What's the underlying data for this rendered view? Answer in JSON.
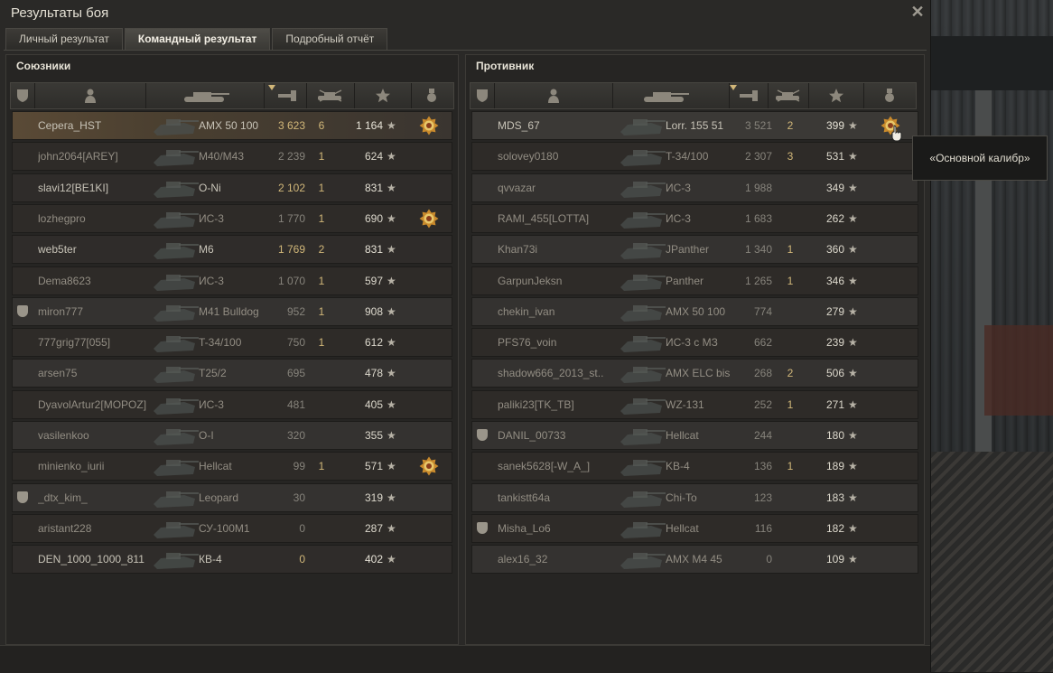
{
  "window": {
    "title": "Результаты боя",
    "close_symbol": "✕"
  },
  "tabs": [
    {
      "label": "Личный результат",
      "active": false
    },
    {
      "label": "Командный результат",
      "active": true
    },
    {
      "label": "Подробный отчёт",
      "active": false
    }
  ],
  "allies": {
    "title": "Союзники",
    "rows": [
      {
        "clan_icon": false,
        "name": "Серега_HST",
        "vehicle": "AMX 50 100",
        "damage": "3 623",
        "damage_gold": true,
        "kills": "6",
        "xp": "1 164",
        "medal": true,
        "style": "self"
      },
      {
        "clan_icon": false,
        "name": "john2064[AREY]",
        "vehicle": "M40/M43",
        "damage": "2 239",
        "damage_gold": false,
        "kills": "1",
        "xp": "624",
        "medal": false,
        "style": "faded"
      },
      {
        "clan_icon": false,
        "name": "slavi12[BE1KI]",
        "vehicle": "O-Ni",
        "damage": "2 102",
        "damage_gold": true,
        "kills": "1",
        "xp": "831",
        "medal": false,
        "style": "bright"
      },
      {
        "clan_icon": false,
        "name": "lozhegpro",
        "vehicle": "ИС-3",
        "damage": "1 770",
        "damage_gold": false,
        "kills": "1",
        "xp": "690",
        "medal": true,
        "style": "faded"
      },
      {
        "clan_icon": false,
        "name": "web5ter",
        "vehicle": "M6",
        "damage": "1 769",
        "damage_gold": true,
        "kills": "2",
        "xp": "831",
        "medal": false,
        "style": "bright"
      },
      {
        "clan_icon": false,
        "name": "Dema8623",
        "vehicle": "ИС-3",
        "damage": "1 070",
        "damage_gold": false,
        "kills": "1",
        "xp": "597",
        "medal": false,
        "style": "faded"
      },
      {
        "clan_icon": true,
        "name": "miron777",
        "vehicle": "M41 Bulldog",
        "damage": "952",
        "damage_gold": false,
        "kills": "1",
        "xp": "908",
        "medal": false,
        "style": "faded"
      },
      {
        "clan_icon": false,
        "name": "777grig77[055]",
        "vehicle": "T-34/100",
        "damage": "750",
        "damage_gold": false,
        "kills": "1",
        "xp": "612",
        "medal": false,
        "style": "faded"
      },
      {
        "clan_icon": false,
        "name": "arsen75",
        "vehicle": "T25/2",
        "damage": "695",
        "damage_gold": false,
        "kills": "",
        "xp": "478",
        "medal": false,
        "style": "faded"
      },
      {
        "clan_icon": false,
        "name": "DyavolArtur2[MOPOZ]",
        "vehicle": "ИС-3",
        "damage": "481",
        "damage_gold": false,
        "kills": "",
        "xp": "405",
        "medal": false,
        "style": "faded"
      },
      {
        "clan_icon": false,
        "name": "vasilenkoo",
        "vehicle": "O-I",
        "damage": "320",
        "damage_gold": false,
        "kills": "",
        "xp": "355",
        "medal": false,
        "style": "faded"
      },
      {
        "clan_icon": false,
        "name": "minienko_iurii",
        "vehicle": "Hellcat",
        "damage": "99",
        "damage_gold": false,
        "kills": "1",
        "xp": "571",
        "medal": true,
        "style": "faded"
      },
      {
        "clan_icon": true,
        "name": "_dtx_kim_",
        "vehicle": "Leopard",
        "damage": "30",
        "damage_gold": false,
        "kills": "",
        "xp": "319",
        "medal": false,
        "style": "faded"
      },
      {
        "clan_icon": false,
        "name": "aristant228",
        "vehicle": "СУ-100М1",
        "damage": "0",
        "damage_gold": false,
        "kills": "",
        "xp": "287",
        "medal": false,
        "style": "faded"
      },
      {
        "clan_icon": false,
        "name": "DEN_1000_1000_811",
        "vehicle": "КВ-4",
        "damage": "0",
        "damage_gold": true,
        "kills": "",
        "xp": "402",
        "medal": false,
        "style": "bright"
      }
    ]
  },
  "enemies": {
    "title": "Противник",
    "rows": [
      {
        "clan_icon": false,
        "name": "MDS_67",
        "vehicle": "Lorr. 155 51",
        "damage": "3 521",
        "damage_gold": false,
        "kills": "2",
        "xp": "399",
        "medal": true,
        "style": "hover"
      },
      {
        "clan_icon": false,
        "name": "solovey0180",
        "vehicle": "T-34/100",
        "damage": "2 307",
        "damage_gold": false,
        "kills": "3",
        "xp": "531",
        "medal": false,
        "style": "faded"
      },
      {
        "clan_icon": false,
        "name": "qvvazar",
        "vehicle": "ИС-3",
        "damage": "1 988",
        "damage_gold": false,
        "kills": "",
        "xp": "349",
        "medal": false,
        "style": "faded"
      },
      {
        "clan_icon": false,
        "name": "RAMI_455[LOTTA]",
        "vehicle": "ИС-3",
        "damage": "1 683",
        "damage_gold": false,
        "kills": "",
        "xp": "262",
        "medal": false,
        "style": "faded"
      },
      {
        "clan_icon": false,
        "name": "Khan73i",
        "vehicle": "JPanther",
        "damage": "1 340",
        "damage_gold": false,
        "kills": "1",
        "xp": "360",
        "medal": false,
        "style": "faded"
      },
      {
        "clan_icon": false,
        "name": "GarpunJeksn",
        "vehicle": "Panther",
        "damage": "1 265",
        "damage_gold": false,
        "kills": "1",
        "xp": "346",
        "medal": false,
        "style": "faded"
      },
      {
        "clan_icon": false,
        "name": "chekin_ivan",
        "vehicle": "AMX 50 100",
        "damage": "774",
        "damage_gold": false,
        "kills": "",
        "xp": "279",
        "medal": false,
        "style": "faded"
      },
      {
        "clan_icon": false,
        "name": "PFS76_voin",
        "vehicle": "ИС-3 с МЗ",
        "damage": "662",
        "damage_gold": false,
        "kills": "",
        "xp": "239",
        "medal": false,
        "style": "faded"
      },
      {
        "clan_icon": false,
        "name": "shadow666_2013_st..",
        "vehicle": "AMX ELC bis",
        "damage": "268",
        "damage_gold": false,
        "kills": "2",
        "xp": "506",
        "medal": false,
        "style": "faded"
      },
      {
        "clan_icon": false,
        "name": "paliki23[TK_TB]",
        "vehicle": "WZ-131",
        "damage": "252",
        "damage_gold": false,
        "kills": "1",
        "xp": "271",
        "medal": false,
        "style": "faded"
      },
      {
        "clan_icon": true,
        "name": "DANIL_00733",
        "vehicle": "Hellcat",
        "damage": "244",
        "damage_gold": false,
        "kills": "",
        "xp": "180",
        "medal": false,
        "style": "faded"
      },
      {
        "clan_icon": false,
        "name": "sanek5628[-W_A_]",
        "vehicle": "KB-4",
        "damage": "136",
        "damage_gold": false,
        "kills": "1",
        "xp": "189",
        "medal": false,
        "style": "faded"
      },
      {
        "clan_icon": false,
        "name": "tankistt64a",
        "vehicle": "Chi-To",
        "damage": "123",
        "damage_gold": false,
        "kills": "",
        "xp": "183",
        "medal": false,
        "style": "faded"
      },
      {
        "clan_icon": true,
        "name": "Misha_Lo6",
        "vehicle": "Hellcat",
        "damage": "116",
        "damage_gold": false,
        "kills": "",
        "xp": "182",
        "medal": false,
        "style": "faded"
      },
      {
        "clan_icon": false,
        "name": "alex16_32",
        "vehicle": "AMX M4 45",
        "damage": "0",
        "damage_gold": false,
        "kills": "",
        "xp": "109",
        "medal": false,
        "style": "faded"
      }
    ]
  },
  "xp_star": "★",
  "tooltip": {
    "text": "«Основной калибр»"
  },
  "colors": {
    "gold": "#d1b779",
    "text": "#c7c3b7",
    "bg": "#2a2927"
  }
}
